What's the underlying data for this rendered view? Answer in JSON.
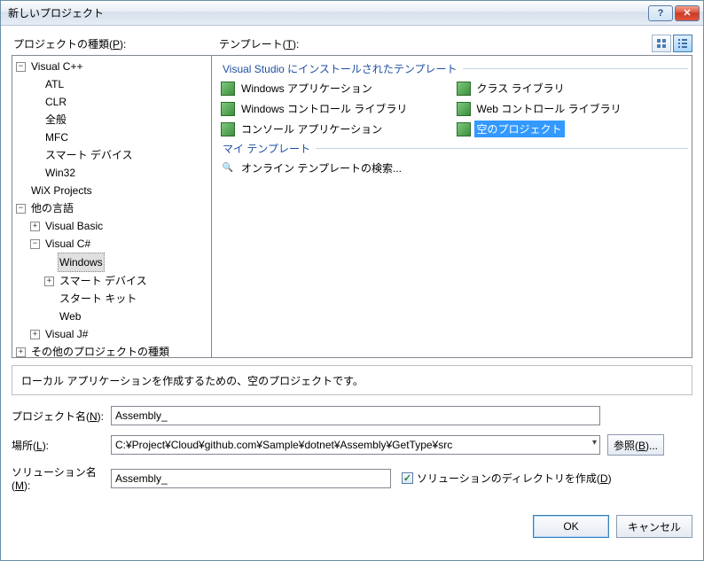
{
  "window": {
    "title": "新しいプロジェクト"
  },
  "labels": {
    "project_types": "プロジェクトの種類(",
    "project_types_key": "P",
    "project_types_suffix": "):",
    "templates": "テンプレート(",
    "templates_key": "T",
    "templates_suffix": "):"
  },
  "tree": {
    "vcpp": "Visual C++",
    "atl": "ATL",
    "clr": "CLR",
    "general": "全般",
    "mfc": "MFC",
    "smart_device": "スマート デバイス",
    "win32": "Win32",
    "wix": "WiX Projects",
    "other_lang": "他の言語",
    "vb": "Visual Basic",
    "vcs": "Visual C#",
    "windows": "Windows",
    "smart_device2": "スマート デバイス",
    "starter": "スタート キット",
    "web": "Web",
    "vjsharp": "Visual J#",
    "other_projects": "その他のプロジェクトの種類"
  },
  "groups": {
    "installed": "Visual Studio にインストールされたテンプレート",
    "my": "マイ テンプレート"
  },
  "templates": {
    "win_app": "Windows アプリケーション",
    "class_lib": "クラス ライブラリ",
    "win_ctrl": "Windows コントロール ライブラリ",
    "web_ctrl": "Web コントロール ライブラリ",
    "console": "コンソール アプリケーション",
    "empty": "空のプロジェクト",
    "online_search": "オンライン テンプレートの検索..."
  },
  "description": "ローカル アプリケーションを作成するための、空のプロジェクトです。",
  "form": {
    "project_name_label": "プロジェクト名(",
    "project_name_key": "N",
    "project_name_suffix": "):",
    "project_name_value": "Assembly_",
    "location_label": "場所(",
    "location_key": "L",
    "location_suffix": "):",
    "location_value": "C:¥Project¥Cloud¥github.com¥Sample¥dotnet¥Assembly¥GetType¥src",
    "browse": "参照(",
    "browse_key": "B",
    "browse_suffix": ")...",
    "solution_name_label": "ソリューション名(",
    "solution_name_key": "M",
    "solution_name_suffix": "):",
    "solution_name_value": "Assembly_",
    "create_dir": "ソリューションのディレクトリを作成(",
    "create_dir_key": "D",
    "create_dir_suffix": ")"
  },
  "buttons": {
    "ok": "OK",
    "cancel": "キャンセル"
  }
}
